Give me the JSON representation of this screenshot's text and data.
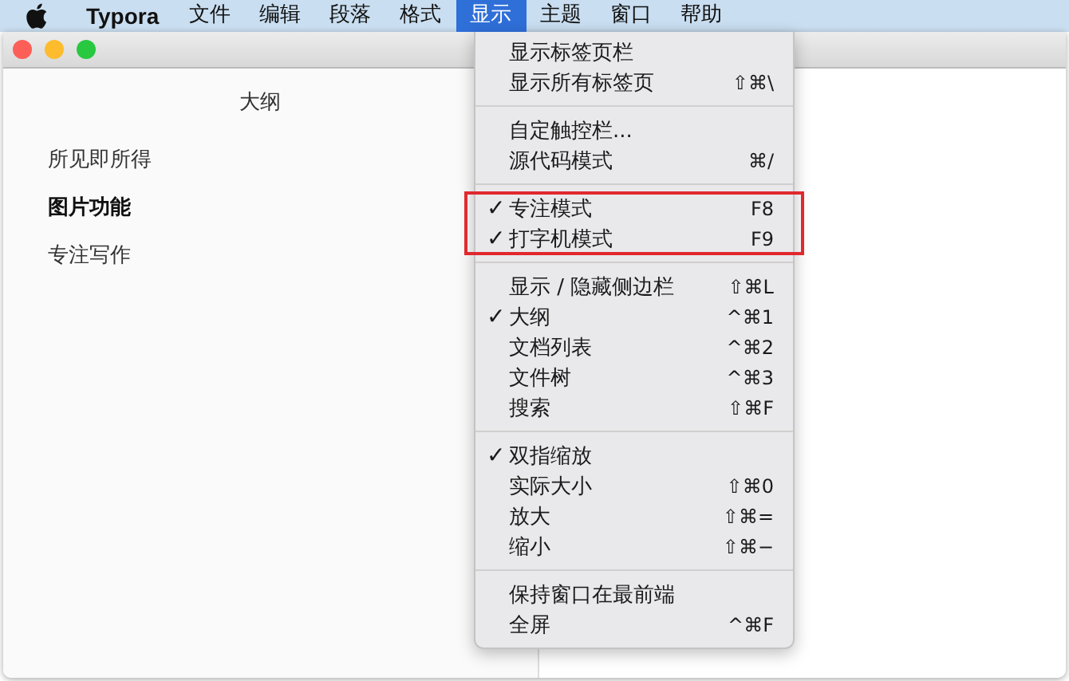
{
  "menubar": {
    "app_name": "Typora",
    "items": [
      {
        "label": "文件",
        "selected": false
      },
      {
        "label": "编辑",
        "selected": false
      },
      {
        "label": "段落",
        "selected": false
      },
      {
        "label": "格式",
        "selected": false
      },
      {
        "label": "显示",
        "selected": true
      },
      {
        "label": "主题",
        "selected": false
      },
      {
        "label": "窗口",
        "selected": false
      },
      {
        "label": "帮助",
        "selected": false
      }
    ]
  },
  "outline": {
    "title": "大纲",
    "items": [
      {
        "label": "所见即所得",
        "selected": false
      },
      {
        "label": "图片功能",
        "selected": true
      },
      {
        "label": "专注写作",
        "selected": false
      }
    ]
  },
  "menu": {
    "check_mark": "✓",
    "groups": [
      {
        "highlighted": false,
        "items": [
          {
            "label": "显示标签页栏",
            "checked": false
          },
          {
            "label": "显示所有标签页",
            "shortcut": "⇧⌘\\",
            "checked": false
          }
        ]
      },
      {
        "highlighted": false,
        "items": [
          {
            "label": "自定触控栏...",
            "checked": false
          },
          {
            "label": "源代码模式",
            "shortcut": "⌘/",
            "checked": false
          }
        ]
      },
      {
        "highlighted": true,
        "items": [
          {
            "label": "专注模式",
            "shortcut": "F8",
            "checked": true
          },
          {
            "label": "打字机模式",
            "shortcut": "F9",
            "checked": true
          }
        ]
      },
      {
        "highlighted": false,
        "items": [
          {
            "label": "显示 / 隐藏侧边栏",
            "shortcut": "⇧⌘L",
            "checked": false
          },
          {
            "label": "大纲",
            "shortcut": "^⌘1",
            "checked": true
          },
          {
            "label": "文档列表",
            "shortcut": "^⌘2",
            "checked": false
          },
          {
            "label": "文件树",
            "shortcut": "^⌘3",
            "checked": false
          },
          {
            "label": "搜索",
            "shortcut": "⇧⌘F",
            "checked": false
          }
        ]
      },
      {
        "highlighted": false,
        "items": [
          {
            "label": "双指缩放",
            "checked": true
          },
          {
            "label": "实际大小",
            "shortcut": "⇧⌘0",
            "checked": false
          },
          {
            "label": "放大",
            "shortcut": "⇧⌘=",
            "checked": false
          },
          {
            "label": "缩小",
            "shortcut": "⇧⌘−",
            "checked": false
          }
        ]
      },
      {
        "highlighted": false,
        "items": [
          {
            "label": "保持窗口在最前端",
            "checked": false
          },
          {
            "label": "全屏",
            "shortcut": "^⌘F",
            "checked": false
          }
        ]
      }
    ]
  }
}
